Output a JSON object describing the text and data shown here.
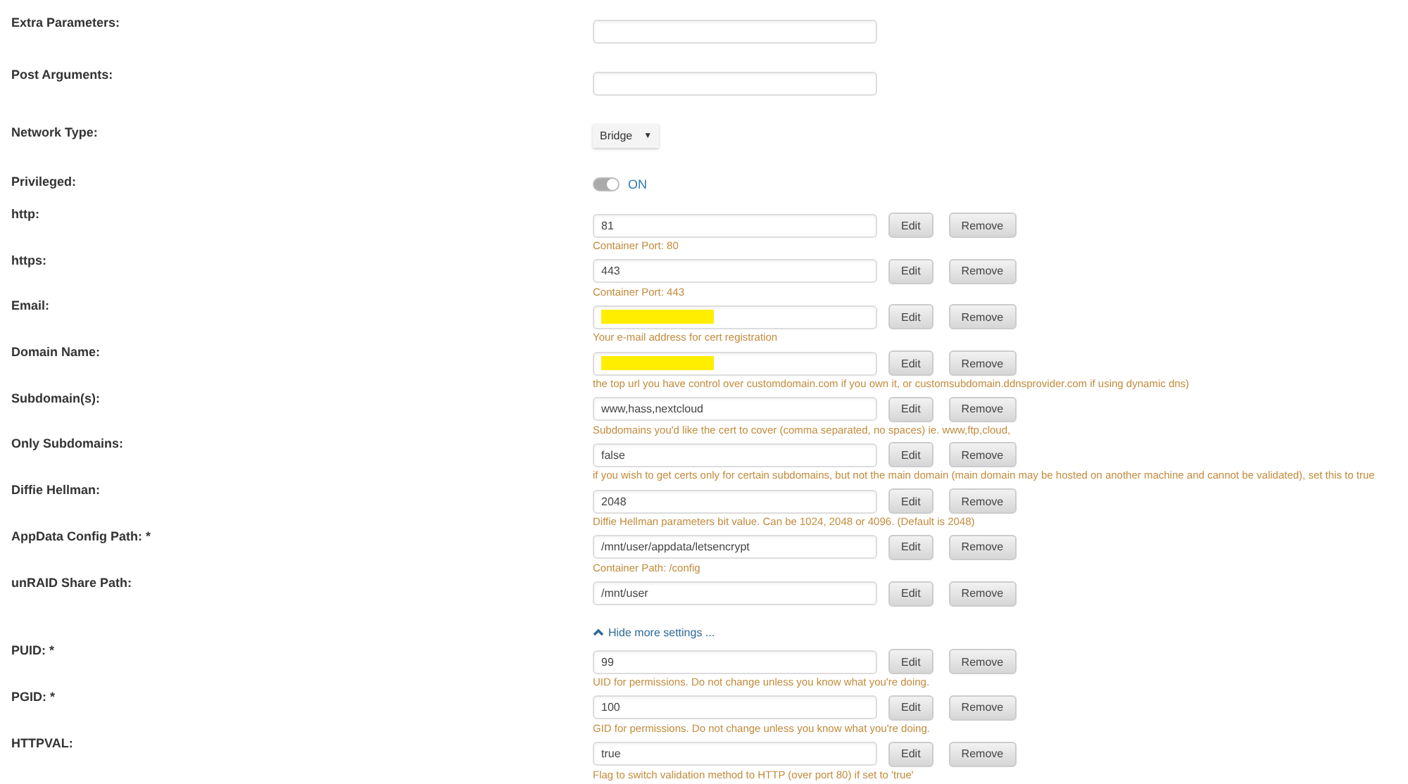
{
  "rows": [
    {
      "kind": "input",
      "label": "Extra Parameters:",
      "value": ""
    },
    {
      "kind": "input",
      "label": "Post Arguments:",
      "value": ""
    },
    {
      "kind": "select",
      "label": "Network Type:",
      "value": "Bridge",
      "caret": "▼"
    },
    {
      "kind": "toggle",
      "label": "Privileged:",
      "on": true,
      "state_text": "ON"
    },
    {
      "kind": "path",
      "label": "http:",
      "value": "81",
      "redacted": false,
      "description": "Container Port: 80",
      "buttons": [
        "Edit",
        "Remove"
      ]
    },
    {
      "kind": "path",
      "label": "https:",
      "value": "443",
      "redacted": false,
      "description": "Container Port: 443",
      "buttons": [
        "Edit",
        "Remove"
      ]
    },
    {
      "kind": "path",
      "label": "Email:",
      "redacted": true,
      "description": "Your e-mail address for cert registration",
      "buttons": [
        "Edit",
        "Remove"
      ]
    },
    {
      "kind": "path",
      "label": "Domain Name:",
      "redacted": true,
      "description": "the top url you have control over customdomain.com if you own it, or customsubdomain.ddnsprovider.com if using dynamic dns)",
      "buttons": [
        "Edit",
        "Remove"
      ]
    },
    {
      "kind": "path",
      "label": "Subdomain(s):",
      "value": "www,hass,nextcloud",
      "redacted": false,
      "description": "Subdomains you'd like the cert to cover (comma separated, no spaces) ie. www,ftp,cloud,",
      "buttons": [
        "Edit",
        "Remove"
      ]
    },
    {
      "kind": "path",
      "label": "Only Subdomains:",
      "value": "false",
      "redacted": false,
      "description": "if you wish to get certs only for certain subdomains, but not the main domain (main domain may be hosted on another machine and cannot be validated), set this to true",
      "buttons": [
        "Edit",
        "Remove"
      ]
    },
    {
      "kind": "path",
      "label": "Diffie Hellman:",
      "value": "2048",
      "redacted": false,
      "description": "Diffie Hellman parameters bit value. Can be 1024, 2048 or 4096. (Default is 2048)",
      "buttons": [
        "Edit",
        "Remove"
      ]
    },
    {
      "kind": "path",
      "label": "AppData Config Path: *",
      "value": "/mnt/user/appdata/letsencrypt",
      "redacted": false,
      "description": "Container Path: /config",
      "buttons": [
        "Edit",
        "Remove"
      ]
    },
    {
      "kind": "path",
      "label": "unRAID Share Path:",
      "value": "/mnt/user",
      "redacted": false,
      "buttons": [
        "Edit",
        "Remove"
      ]
    },
    {
      "kind": "link",
      "text": "Hide more settings ..."
    },
    {
      "kind": "path",
      "label": "PUID: *",
      "value": "99",
      "redacted": false,
      "description": "UID for permissions. Do not change unless you know what you're doing.",
      "buttons": [
        "Edit",
        "Remove"
      ]
    },
    {
      "kind": "path",
      "label": "PGID: *",
      "value": "100",
      "redacted": false,
      "description": "GID for permissions. Do not change unless you know what you're doing.",
      "buttons": [
        "Edit",
        "Remove"
      ]
    },
    {
      "kind": "path",
      "label": "HTTPVAL:",
      "value": "true",
      "redacted": false,
      "description": "Flag to switch validation method to HTTP (over port 80) if set to 'true'",
      "buttons": [
        "Edit",
        "Remove"
      ]
    }
  ]
}
